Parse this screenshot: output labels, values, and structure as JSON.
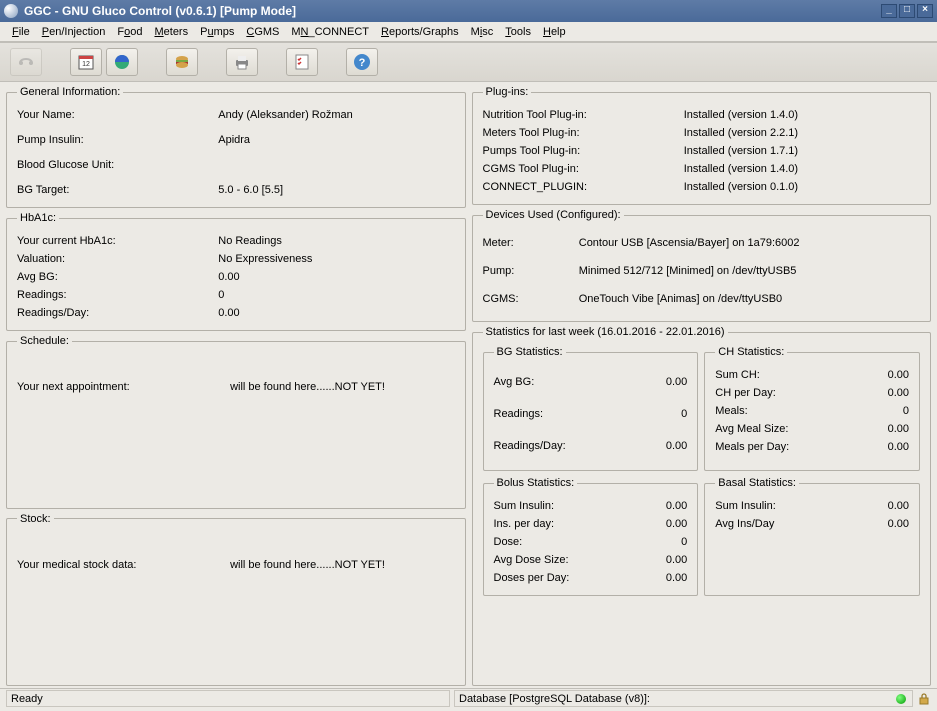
{
  "window": {
    "title": "GGC - GNU Gluco Control (v0.6.1) [Pump Mode]"
  },
  "menu": [
    "File",
    "Pen/Injection",
    "Food",
    "Meters",
    "Pumps",
    "CGMS",
    "MN_CONNECT",
    "Reports/Graphs",
    "Misc",
    "Tools",
    "Help"
  ],
  "general": {
    "legend": "General Information:",
    "name_lbl": "Your Name:",
    "name_val": "Andy (Aleksander) Rožman",
    "pump_lbl": "Pump Insulin:",
    "pump_val": "Apidra",
    "bgu_lbl": "Blood Glucose Unit:",
    "bgu_val": "",
    "bgt_lbl": "BG Target:",
    "bgt_val": "5.0 - 6.0 [5.5]"
  },
  "hba1c": {
    "legend": "HbA1c:",
    "cur_lbl": "Your current HbA1c:",
    "cur_val": "No Readings",
    "valu_lbl": "Valuation:",
    "valu_val": "No Expressiveness",
    "avg_lbl": "Avg BG:",
    "avg_val": "0.00",
    "read_lbl": "Readings:",
    "read_val": "0",
    "rpd_lbl": "Readings/Day:",
    "rpd_val": "0.00"
  },
  "schedule": {
    "legend": "Schedule:",
    "appt_lbl": "Your next appointment:",
    "appt_val": "will be found here......NOT YET!"
  },
  "stock": {
    "legend": "Stock:",
    "lbl": "Your medical stock data:",
    "val": "will be found here......NOT YET!"
  },
  "plugins": {
    "legend": "Plug-ins:",
    "items": [
      {
        "name": "Nutrition Tool Plug-in:",
        "status": "Installed (version 1.4.0)"
      },
      {
        "name": "Meters Tool Plug-in:",
        "status": "Installed (version 2.2.1)"
      },
      {
        "name": "Pumps Tool Plug-in:",
        "status": "Installed (version 1.7.1)"
      },
      {
        "name": "CGMS Tool Plug-in:",
        "status": "Installed (version 1.4.0)"
      },
      {
        "name": "CONNECT_PLUGIN:",
        "status": "Installed (version 0.1.0)"
      }
    ]
  },
  "devices": {
    "legend": "Devices Used (Configured):",
    "meter_lbl": "Meter:",
    "meter_val": "Contour USB [Ascensia/Bayer] on 1a79:6002",
    "pump_lbl": "Pump:",
    "pump_val": "Minimed 512/712 [Minimed] on /dev/ttyUSB5",
    "cgms_lbl": "CGMS:",
    "cgms_val": "OneTouch Vibe [Animas] on /dev/ttyUSB0"
  },
  "stats": {
    "legend": "Statistics for last week (16.01.2016 - 22.01.2016)",
    "bg": {
      "legend": "BG Statistics:",
      "avg_lbl": "Avg BG:",
      "avg_val": "0.00",
      "read_lbl": "Readings:",
      "read_val": "0",
      "rpd_lbl": "Readings/Day:",
      "rpd_val": "0.00"
    },
    "ch": {
      "legend": "CH Statistics:",
      "sum_lbl": "Sum CH:",
      "sum_val": "0.00",
      "cpd_lbl": "CH per Day:",
      "cpd_val": "0.00",
      "meals_lbl": "Meals:",
      "meals_val": "0",
      "ams_lbl": "Avg Meal Size:",
      "ams_val": "0.00",
      "mpd_lbl": "Meals per Day:",
      "mpd_val": "0.00"
    },
    "bolus": {
      "legend": "Bolus Statistics:",
      "sum_lbl": "Sum Insulin:",
      "sum_val": "0.00",
      "ipd_lbl": "Ins. per day:",
      "ipd_val": "0.00",
      "dose_lbl": "Dose:",
      "dose_val": "0",
      "ads_lbl": "Avg Dose Size:",
      "ads_val": "0.00",
      "dpd_lbl": "Doses per Day:",
      "dpd_val": "0.00"
    },
    "basal": {
      "legend": "Basal Statistics:",
      "sum_lbl": "Sum Insulin:",
      "sum_val": "0.00",
      "aid_lbl": "Avg Ins/Day",
      "aid_val": "0.00"
    }
  },
  "status": {
    "left": "Ready",
    "right": "Database [PostgreSQL Database (v8)]:"
  }
}
